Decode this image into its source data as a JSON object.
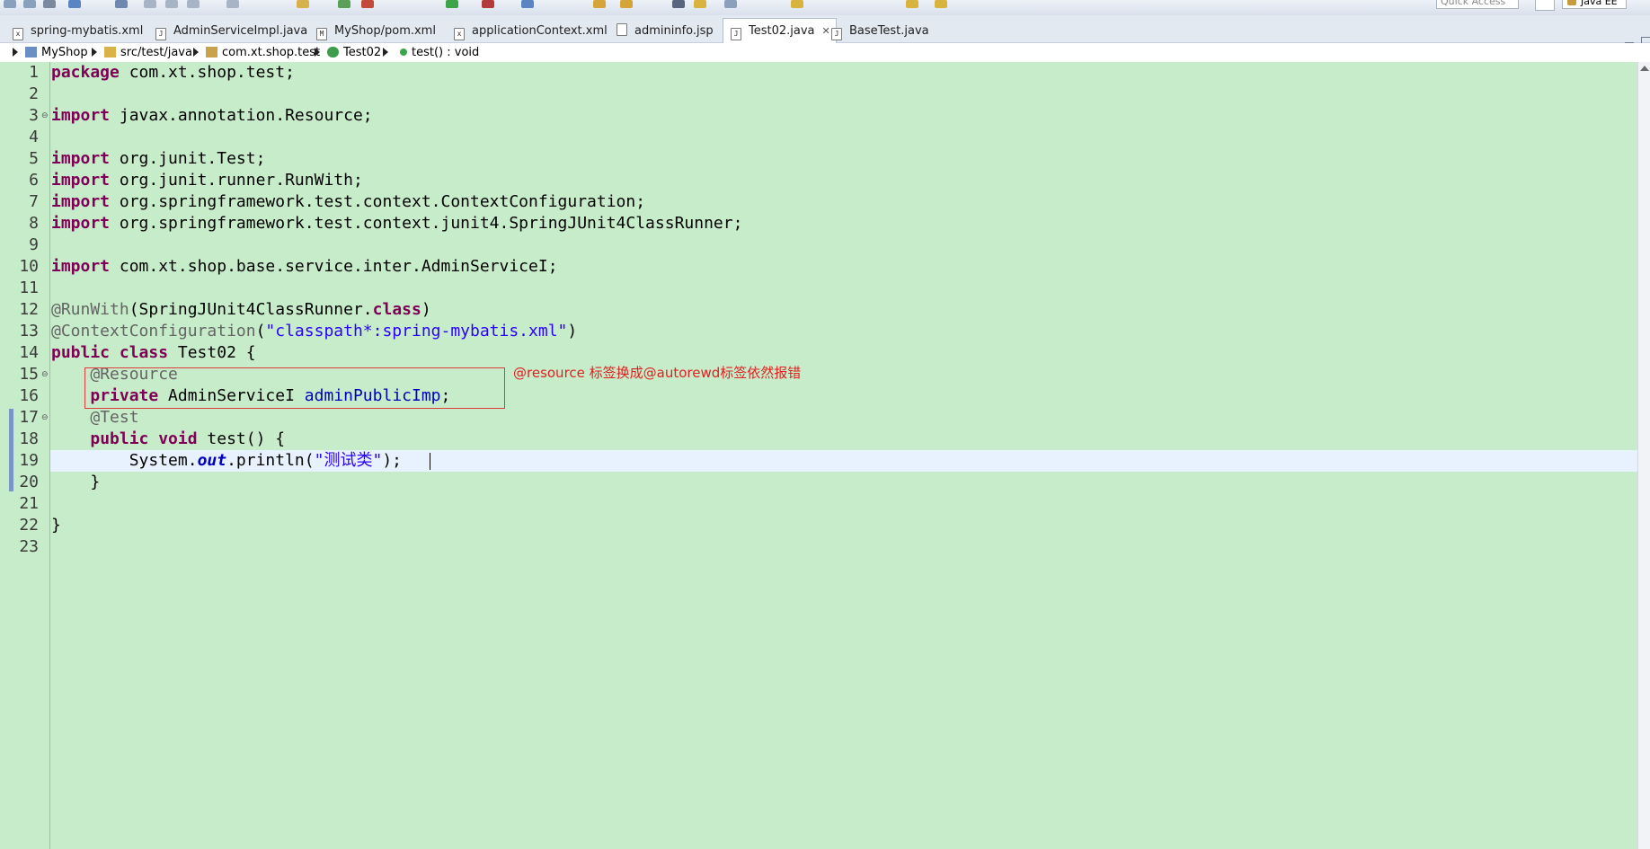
{
  "toolbar": {
    "quick_access_placeholder": "Quick Access",
    "perspective": "Java EE"
  },
  "tabs": [
    {
      "label": "spring-mybatis.xml",
      "icon": "xml-file-icon"
    },
    {
      "label": "AdminServiceImpl.java",
      "icon": "java-file-icon"
    },
    {
      "label": "MyShop/pom.xml",
      "icon": "maven-file-icon"
    },
    {
      "label": "applicationContext.xml",
      "icon": "xml-file-icon"
    },
    {
      "label": "admininfo.jsp",
      "icon": "jsp-file-icon"
    },
    {
      "label": "Test02.java",
      "icon": "java-file-icon",
      "active": true,
      "close": "✕"
    },
    {
      "label": "BaseTest.java",
      "icon": "java-file-icon"
    }
  ],
  "breadcrumb": [
    "MyShop",
    "src/test/java",
    "com.xt.shop.test",
    "Test02",
    "test() : void"
  ],
  "line_numbers": [
    "1",
    "2",
    "3",
    "4",
    "5",
    "6",
    "7",
    "8",
    "9",
    "10",
    "11",
    "12",
    "13",
    "14",
    "15",
    "16",
    "17",
    "18",
    "19",
    "20",
    "21",
    "22",
    "23"
  ],
  "code": {
    "l1_kw": "package",
    "l1_rest": " com.xt.shop.test;",
    "l3_kw": "import",
    "l3_rest": " javax.annotation.Resource;",
    "l5_kw": "import",
    "l5_rest": " org.junit.Test;",
    "l6_kw": "import",
    "l6_rest": " org.junit.runner.RunWith;",
    "l7_kw": "import",
    "l7_rest": " org.springframework.test.context.ContextConfiguration;",
    "l8_kw": "import",
    "l8_rest": " org.springframework.test.context.junit4.SpringJUnit4ClassRunner;",
    "l10_kw": "import",
    "l10_rest": " com.xt.shop.base.service.inter.AdminServiceI;",
    "l12_ann": "@RunWith",
    "l12_a": "(SpringJUnit4ClassRunner.",
    "l12_kw": "class",
    "l12_b": ")",
    "l13_ann": "@ContextConfiguration",
    "l13_a": "(",
    "l13_str": "\"classpath*:spring-mybatis.xml\"",
    "l13_b": ")",
    "l14_kw": "public class",
    "l14_rest": " Test02 {",
    "l15_ann": "@Resource",
    "l16_kw": "private",
    "l16_type": " AdminServiceI ",
    "l16_fld": "adminPublicImp",
    "l16_end": ";",
    "l17_ann": "@Test",
    "l18_kw": "public void",
    "l18_rest": " test() {",
    "l19_a": "System.",
    "l19_out": "out",
    "l19_b": ".println(",
    "l19_str": "\"测试类\"",
    "l19_c": ");",
    "l20": "}",
    "l22": "}"
  },
  "annotation_note": "@resource 标签换成@autorewd标签依然报错"
}
